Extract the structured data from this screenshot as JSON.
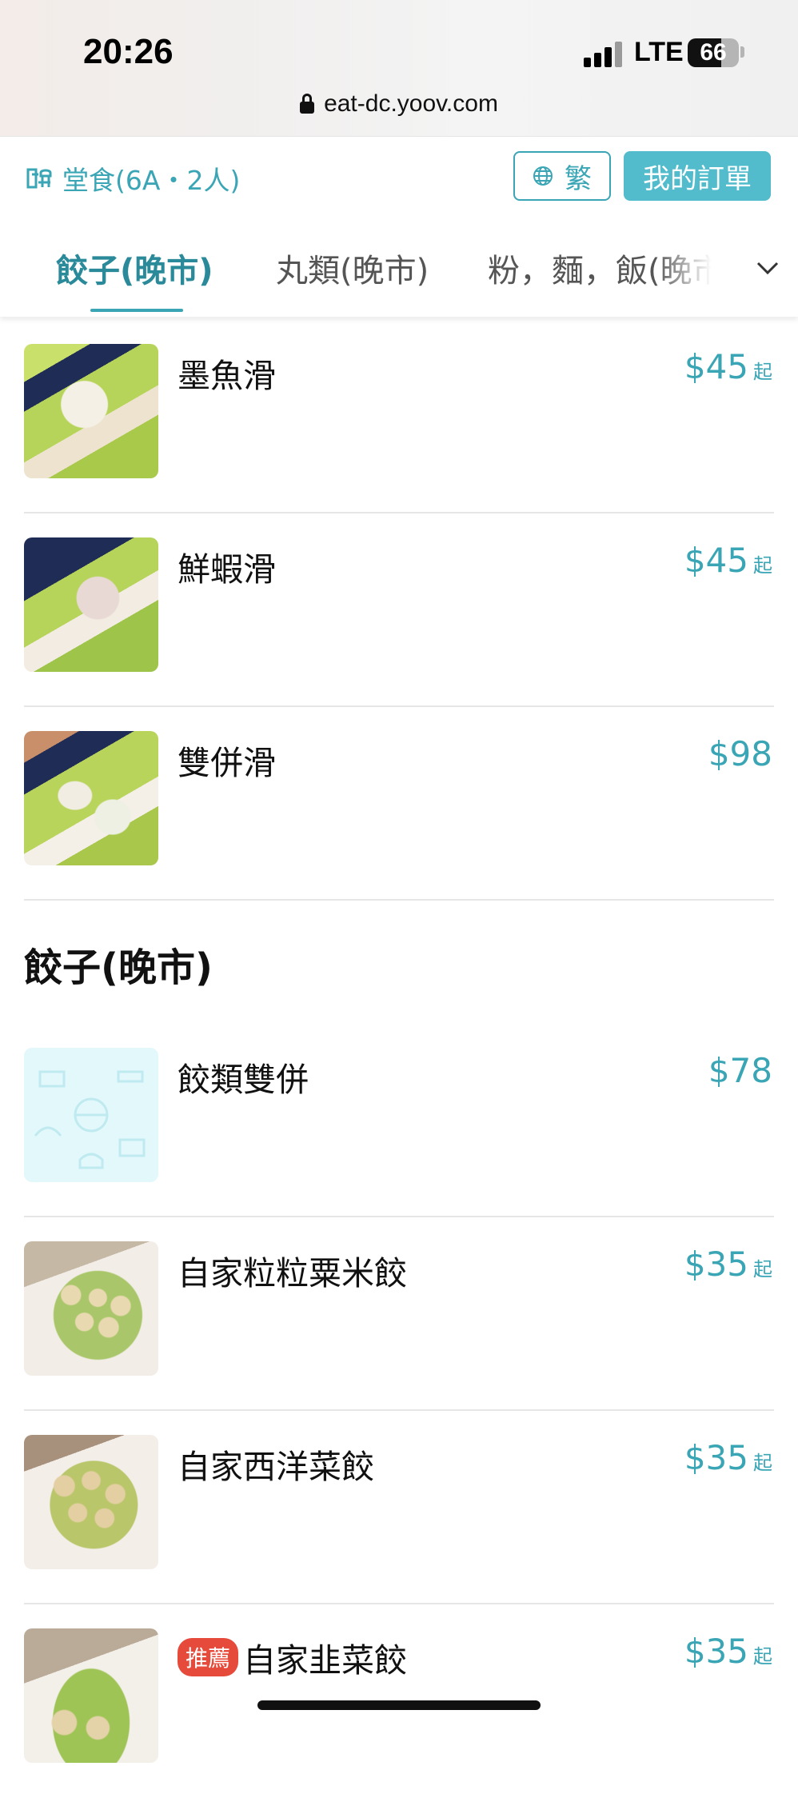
{
  "status_bar": {
    "time": "20:26",
    "network": "LTE",
    "battery": "66"
  },
  "browser": {
    "url": "eat-dc.yoov.com"
  },
  "header": {
    "mode_label": "堂食(6A・2人)",
    "language_label": "繁",
    "orders_button_label": "我的訂單"
  },
  "tabs": [
    {
      "label": "餃子(晚市)",
      "active": true
    },
    {
      "label": "丸類(晚市)",
      "active": false
    },
    {
      "label": "粉，麵，飯(晚市",
      "active": false
    }
  ],
  "items_top": [
    {
      "name": "墨魚滑",
      "price": "$45",
      "price_suffix": "起",
      "image": "cuttlefish-paste-photo"
    },
    {
      "name": "鮮蝦滑",
      "price": "$45",
      "price_suffix": "起",
      "image": "shrimp-paste-photo"
    },
    {
      "name": "雙併滑",
      "price": "$98",
      "price_suffix": "",
      "image": "double-paste-photo"
    }
  ],
  "section": {
    "title": "餃子(晚市)"
  },
  "items_dumplings": [
    {
      "name": "餃類雙併",
      "price": "$78",
      "price_suffix": "",
      "image": "placeholder-food-pattern"
    },
    {
      "name": "自家粒粒粟米餃",
      "price": "$35",
      "price_suffix": "起",
      "image": "corn-dumplings-photo"
    },
    {
      "name": "自家西洋菜餃",
      "price": "$35",
      "price_suffix": "起",
      "image": "watercress-dumplings-photo"
    },
    {
      "name": "自家韭菜餃",
      "price": "$35",
      "price_suffix": "起",
      "badge": "推薦",
      "image": "chive-dumplings-photo"
    }
  ],
  "colors": {
    "accent": "#3aa5b5",
    "button_fill": "#52bccc",
    "badge": "#e64a3b"
  }
}
